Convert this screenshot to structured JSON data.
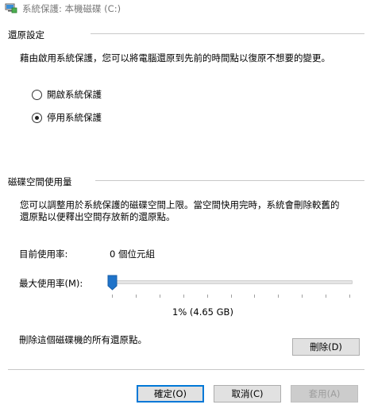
{
  "window": {
    "title": "系統保護: 本機磁碟 (C:)"
  },
  "restore_settings": {
    "header": "還原設定",
    "description": "藉由啟用系統保護，您可以將電腦還原到先前的時間點以復原不想要的變更。",
    "options": [
      {
        "label": "開啟系統保護",
        "checked": false
      },
      {
        "label": "停用系統保護",
        "checked": true
      }
    ]
  },
  "disk_usage": {
    "header": "磁碟空間使用量",
    "description_line1": "您可以調整用於系統保護的磁碟空間上限。當空間快用完時，系統會刪除較舊的",
    "description_line2": "還原點以便釋出空間存放新的還原點。",
    "current_label": "目前使用率:",
    "current_value": "0 個位元組",
    "max_label": "最大使用率(M):",
    "slider_fraction": 0.01,
    "slider_value_label": "1% (4.65 GB)",
    "delete_text": "刪除這個磁碟機的所有還原點。",
    "delete_button": "刪除(D)"
  },
  "footer": {
    "ok": "確定(O)",
    "cancel": "取消(C)",
    "apply": "套用(A)"
  },
  "colors": {
    "accent": "#0078d7",
    "thumb": "#1f73c9",
    "divider": "#c8c8c8"
  },
  "icons": {
    "title": "system-protection-icon",
    "slider_thumb": "slider-thumb"
  }
}
